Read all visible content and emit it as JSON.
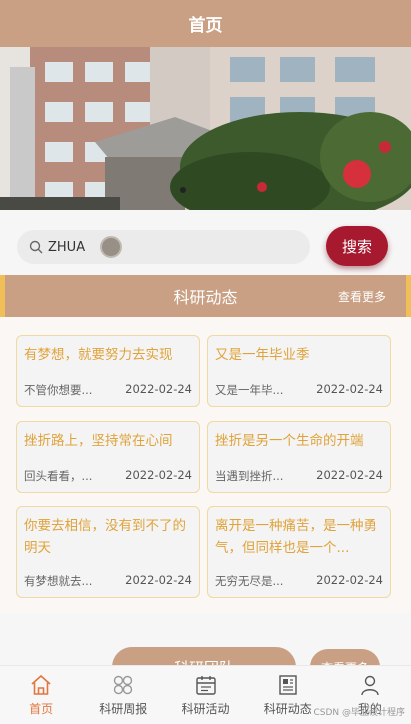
{
  "header": {
    "title": "首页"
  },
  "search": {
    "value": "ZHUA",
    "button_label": "搜索"
  },
  "section": {
    "title": "科研动态",
    "more": "查看更多"
  },
  "cards": [
    {
      "title": "有梦想，就要努力去实现",
      "desc": "不管你想要...",
      "date": "2022-02-24"
    },
    {
      "title": "又是一年毕业季",
      "desc": "又是一年毕...",
      "date": "2022-02-24"
    },
    {
      "title": "挫折路上，坚持常在心间",
      "desc": "回头看看，...",
      "date": "2022-02-24"
    },
    {
      "title": "挫折是另一个生命的开端",
      "desc": "当遇到挫折...",
      "date": "2022-02-24"
    },
    {
      "title": "你要去相信，没有到不了的明天",
      "desc": "有梦想就去...",
      "date": "2022-02-24"
    },
    {
      "title": "离开是一种痛苦，是一种勇气，但同样也是一个...",
      "desc": "无穷无尽是...",
      "date": "2022-02-24"
    }
  ],
  "bottom": {
    "left_label": "科研团队",
    "right_label": "查看更多"
  },
  "tabs": [
    {
      "label": "首页",
      "icon": "home-icon"
    },
    {
      "label": "科研周报",
      "icon": "grid-icon"
    },
    {
      "label": "科研活动",
      "icon": "calendar-icon"
    },
    {
      "label": "科研动态",
      "icon": "news-icon"
    },
    {
      "label": "我的",
      "icon": "user-icon"
    }
  ],
  "watermark": "CSDN @毕业设计程序",
  "colors": {
    "primary": "#c9a084",
    "accent": "#a6192e",
    "card_title": "#e0a33c",
    "active_tab": "#e2763f"
  }
}
